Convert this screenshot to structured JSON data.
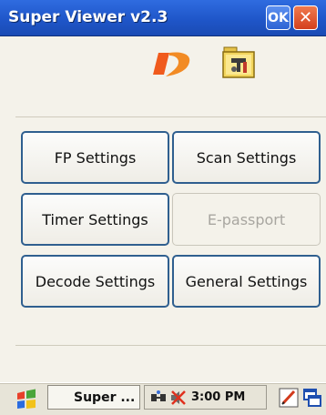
{
  "window": {
    "title": "Super Viewer v2.3",
    "ok_label": "OK",
    "close_label": "✕"
  },
  "settings": {
    "fp": "FP Settings",
    "scan": "Scan Settings",
    "timer": "Timer Settings",
    "epassport": "E-passport",
    "decode": "Decode Settings",
    "general": "General Settings"
  },
  "taskbar": {
    "task_label": "Super ...",
    "time": "3:00 PM"
  },
  "icons": {
    "start": "windows-flag-icon",
    "network": "network-icon",
    "volume": "volume-icon",
    "pen": "pen-input-icon",
    "switch": "window-switch-icon"
  },
  "colors": {
    "titlebar": "#1f56c9",
    "button_border": "#2f5f8f",
    "disabled_text": "#a8a6a0",
    "background": "#f4f2ea"
  }
}
